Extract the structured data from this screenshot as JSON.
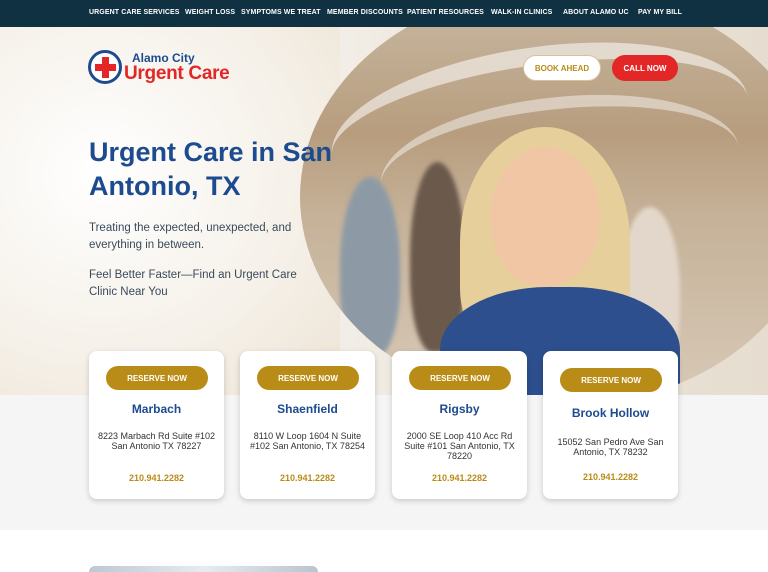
{
  "topnav": {
    "items": [
      "URGENT CARE SERVICES",
      "WEIGHT LOSS",
      "SYMPTOMS WE TREAT",
      "MEMBER DISCOUNTS",
      "PATIENT RESOURCES",
      "WALK-IN CLINICS",
      "ABOUT ALAMO UC",
      "PAY MY BILL"
    ]
  },
  "logo": {
    "line1": "Alamo City",
    "line2": "Urgent Care"
  },
  "header_buttons": {
    "book": "BOOK AHEAD",
    "call": "CALL NOW"
  },
  "hero": {
    "headline": "Urgent Care in San Antonio, TX",
    "subtext1": "Treating the expected, unexpected, and everything in between.",
    "subtext2": "Feel Better Faster—Find an Urgent Care Clinic Near You"
  },
  "locations": [
    {
      "reserve": "RESERVE NOW",
      "name": "Marbach",
      "address": "8223 Marbach Rd Suite #102 San Antonio TX 78227",
      "phone": "210.941.2282"
    },
    {
      "reserve": "RESERVE NOW",
      "name": "Shaenfield",
      "address": "8110 W Loop 1604 N Suite #102 San Antonio, TX 78254",
      "phone": "210.941.2282"
    },
    {
      "reserve": "RESERVE NOW",
      "name": "Rigsby",
      "address": "2000 SE Loop 410 Acc Rd Suite #101 San Antonio, TX 78220",
      "phone": "210.941.2282"
    },
    {
      "reserve": "RESERVE NOW",
      "name": "Brook Hollow",
      "address": "15052 San Pedro Ave San Antonio, TX 78232",
      "phone": "210.941.2282"
    }
  ],
  "colors": {
    "navy": "#0f3142",
    "brand_blue": "#1c4b8f",
    "brand_red": "#e32726",
    "gold": "#b98c17"
  }
}
